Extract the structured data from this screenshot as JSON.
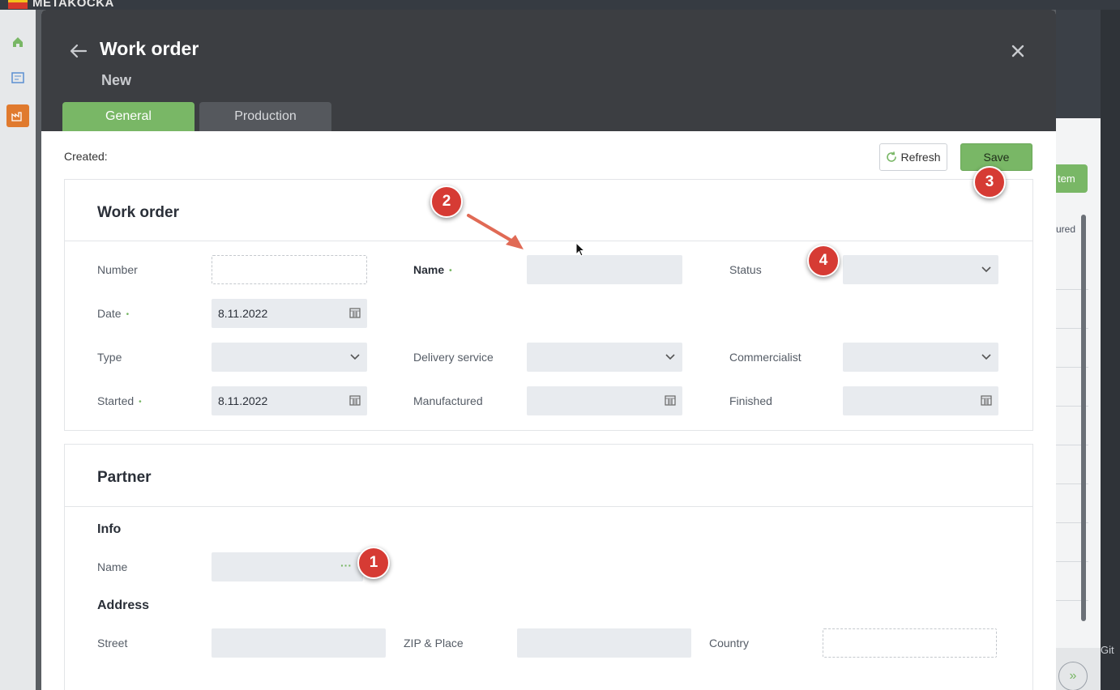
{
  "app": {
    "brand": "METAKOCKA"
  },
  "background": {
    "button_label": "tem",
    "column_label": "ured",
    "footer_text": "Git",
    "expand_glyph": "»"
  },
  "modal": {
    "title": "Work order",
    "subtitle": "New",
    "tabs": [
      {
        "label": "General",
        "active": true
      },
      {
        "label": "Production",
        "active": false
      }
    ],
    "created_label": "Created:",
    "refresh_label": "Refresh",
    "save_label": "Save"
  },
  "work_order": {
    "section_title": "Work order",
    "number": {
      "label": "Number",
      "value": ""
    },
    "name": {
      "label": "Name",
      "value": ""
    },
    "status": {
      "label": "Status",
      "value": ""
    },
    "date": {
      "label": "Date",
      "value": "8.11.2022"
    },
    "type": {
      "label": "Type",
      "value": ""
    },
    "delivery_service": {
      "label": "Delivery service",
      "value": ""
    },
    "commercialist": {
      "label": "Commercialist",
      "value": ""
    },
    "started": {
      "label": "Started",
      "value": "8.11.2022"
    },
    "manufactured": {
      "label": "Manufactured",
      "value": ""
    },
    "finished": {
      "label": "Finished",
      "value": ""
    },
    "required_mark": "•"
  },
  "partner": {
    "section_title": "Partner",
    "info_heading": "Info",
    "name": {
      "label": "Name",
      "value": "",
      "more_glyph": "···"
    },
    "address_heading": "Address",
    "street": {
      "label": "Street",
      "value": ""
    },
    "zip_place": {
      "label": "ZIP & Place",
      "value": ""
    },
    "country": {
      "label": "Country",
      "value": ""
    }
  },
  "annotations": [
    "1",
    "2",
    "3",
    "4"
  ],
  "colors": {
    "accent_green": "#79b766",
    "header_dark": "#3c3e42",
    "badge_red": "#d63b34"
  },
  "icons": [
    "home-icon",
    "dashboard-icon",
    "factory-icon",
    "back-arrow-icon",
    "close-icon",
    "refresh-icon",
    "calendar-icon",
    "chevron-down-icon",
    "more-dots-icon"
  ]
}
